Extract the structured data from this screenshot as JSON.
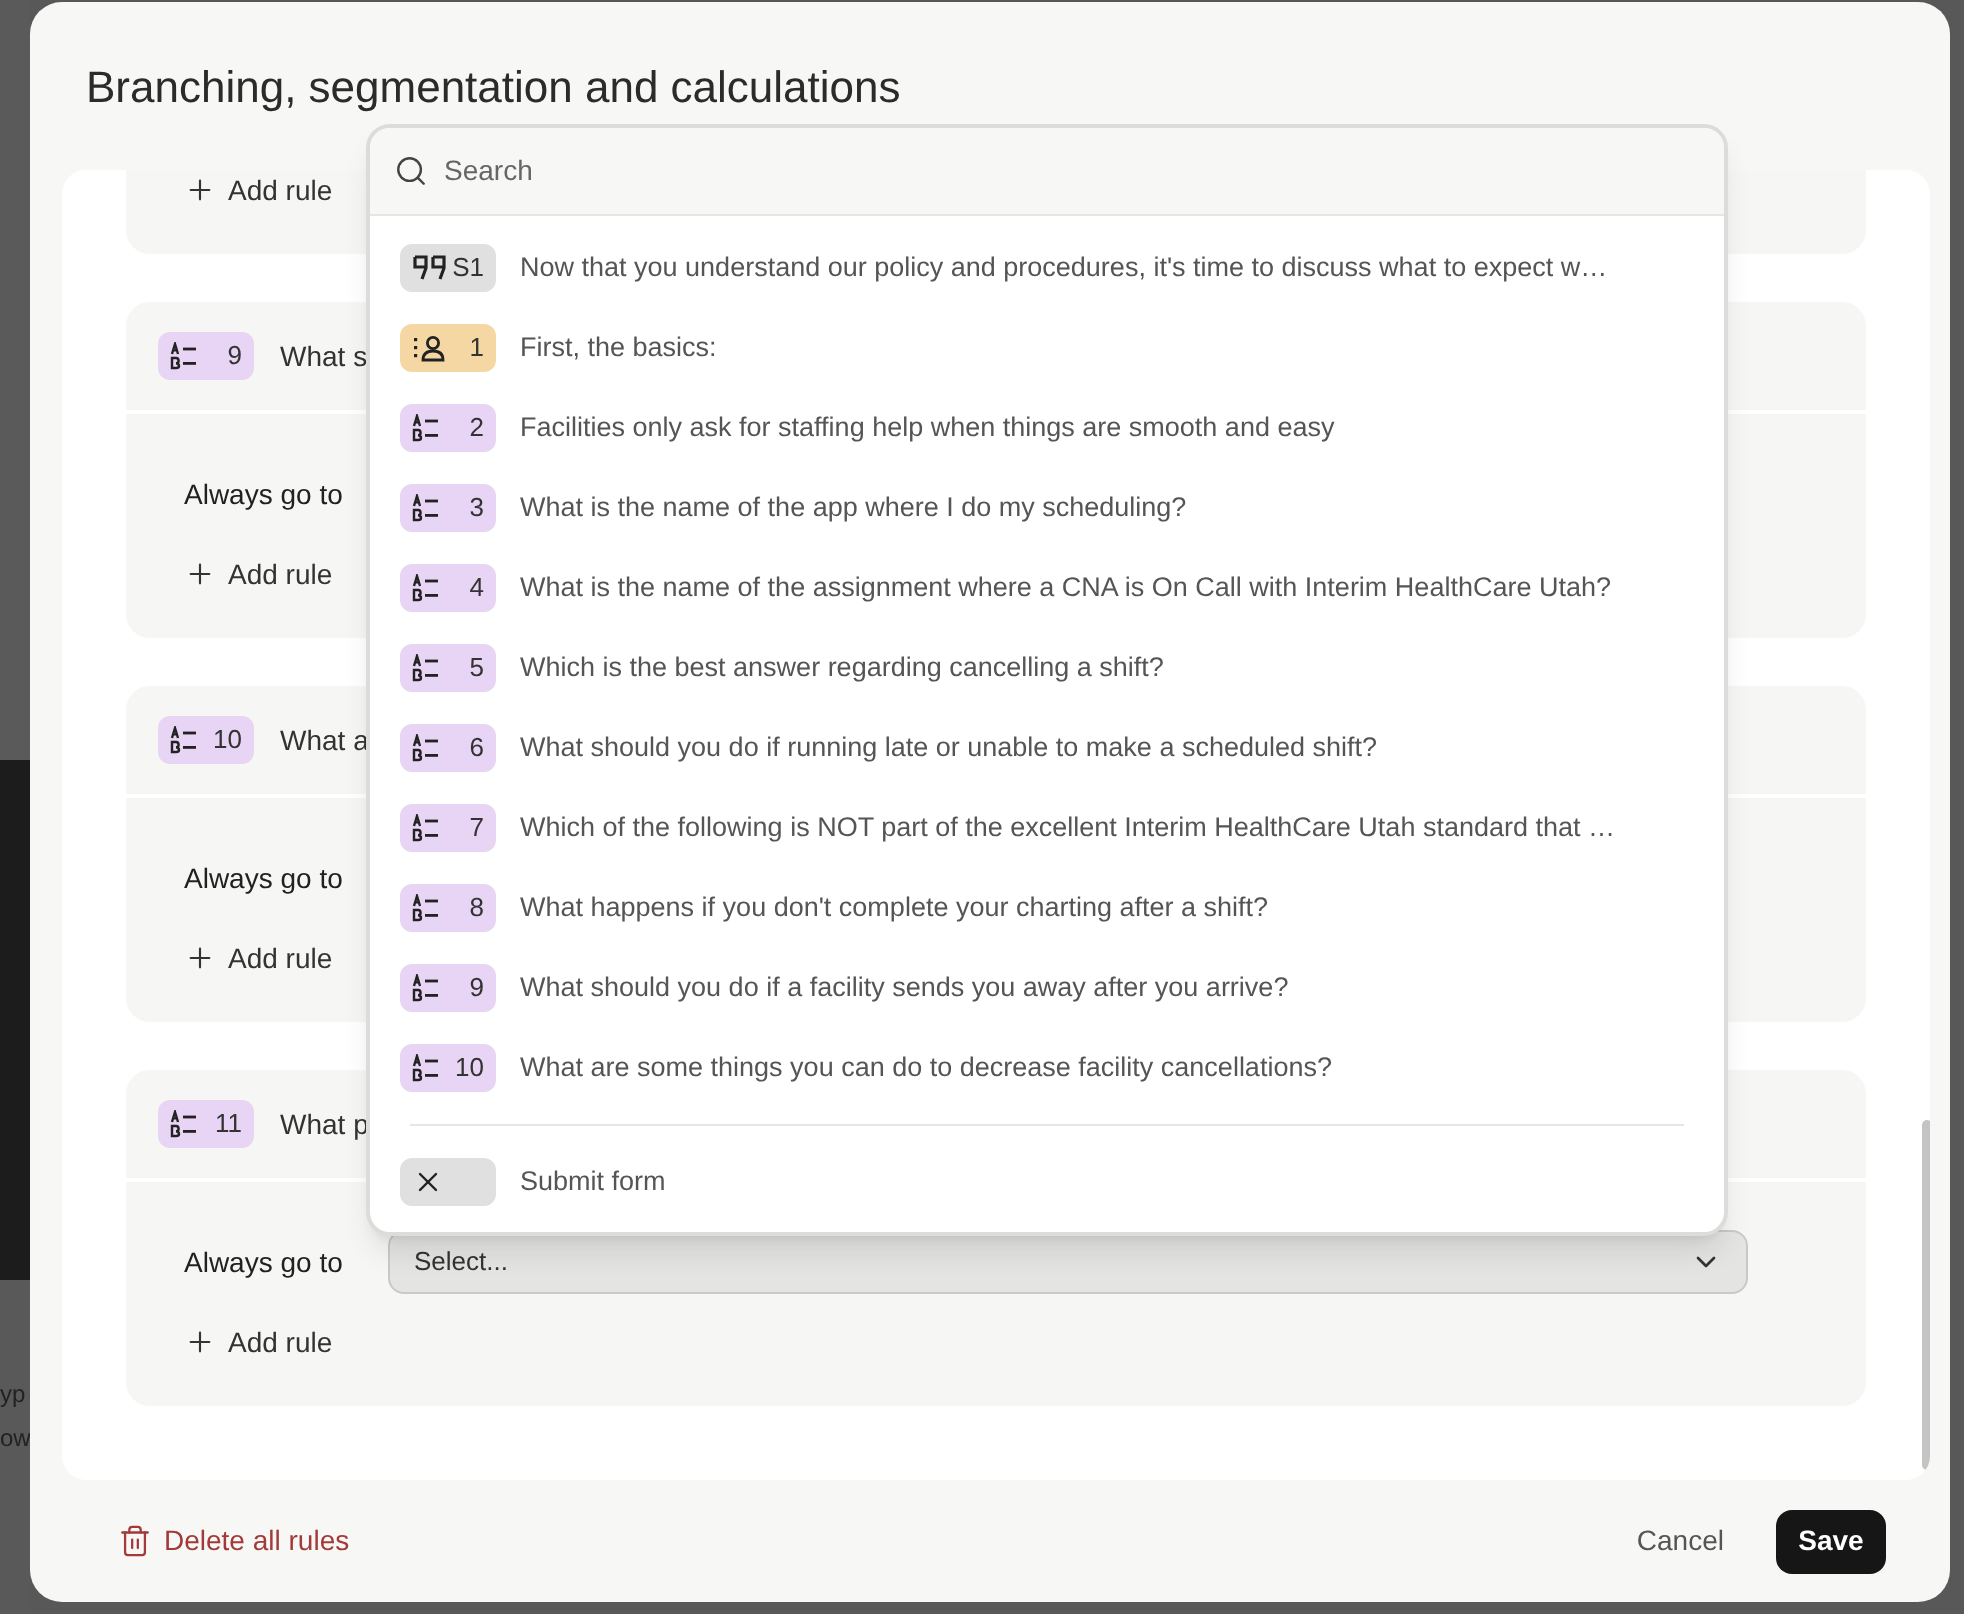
{
  "background_fragments": [
    "yp",
    "ow"
  ],
  "dialog": {
    "title": "Branching, segmentation and calculations"
  },
  "rules": [
    {
      "kind": "partial",
      "add_rule": "Add rule"
    },
    {
      "kind": "question",
      "number": "9",
      "title": "What s",
      "always_go_to": "Always go to",
      "add_rule": "Add rule"
    },
    {
      "kind": "question",
      "number": "10",
      "title": "What a",
      "always_go_to": "Always go to",
      "add_rule": "Add rule"
    },
    {
      "kind": "question",
      "number": "11",
      "title": "What p",
      "always_go_to": "Always go to",
      "select": {
        "placeholder": "Select..."
      },
      "add_rule": "Add rule"
    }
  ],
  "dropdown": {
    "search": {
      "placeholder": "Search"
    },
    "items": [
      {
        "kind": "statement",
        "badge": "S1",
        "text": "Now that you understand our policy and procedures, it's time to discuss what to expect w…"
      },
      {
        "kind": "contact",
        "badge": "1",
        "text": "First, the basics:"
      },
      {
        "kind": "choice",
        "badge": "2",
        "text": "Facilities only ask for staffing help when things are smooth and easy"
      },
      {
        "kind": "choice",
        "badge": "3",
        "text": "What is the name of the app where I do my scheduling?"
      },
      {
        "kind": "choice",
        "badge": "4",
        "text": "What is the name of the assignment where a CNA is On Call with Interim HealthCare Utah?"
      },
      {
        "kind": "choice",
        "badge": "5",
        "text": "Which is the best answer regarding cancelling a shift?"
      },
      {
        "kind": "choice",
        "badge": "6",
        "text": "What should you do if running late or unable to make a scheduled shift?"
      },
      {
        "kind": "choice",
        "badge": "7",
        "text": "Which of the following is NOT part of the excellent Interim HealthCare Utah standard that …"
      },
      {
        "kind": "choice",
        "badge": "8",
        "text": "What happens if you don't complete your charting after a shift?"
      },
      {
        "kind": "choice",
        "badge": "9",
        "text": "What should you do if a facility sends you away after you arrive?"
      },
      {
        "kind": "choice",
        "badge": "10",
        "text": "What are some things you can do to decrease facility cancellations?"
      }
    ],
    "end_item": {
      "kind": "end",
      "text": "Submit form"
    }
  },
  "footer": {
    "delete_all": "Delete all rules",
    "cancel": "Cancel",
    "save": "Save"
  }
}
